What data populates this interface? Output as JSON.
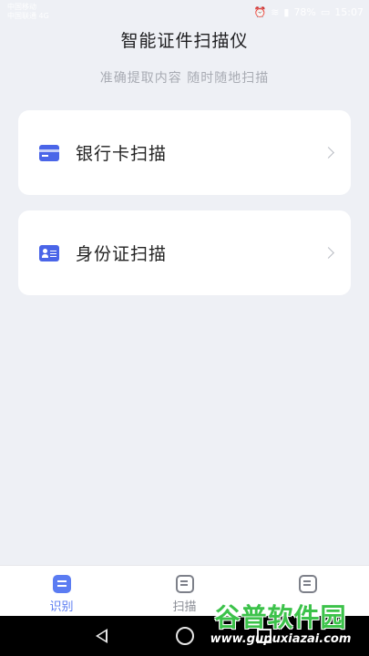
{
  "status_bar": {
    "carrier_line1": "中国移动",
    "carrier_line2": "中国联通 4G",
    "battery": "78%",
    "time": "15:07"
  },
  "header": {
    "title": "智能证件扫描仪",
    "subtitle": "准确提取内容 随时随地扫描"
  },
  "cards": [
    {
      "label": "银行卡扫描",
      "icon": "bank-card-icon"
    },
    {
      "label": "身份证扫描",
      "icon": "id-card-icon"
    }
  ],
  "tabs": [
    {
      "label": "识别",
      "active": true
    },
    {
      "label": "扫描",
      "active": false
    },
    {
      "label": "",
      "active": false
    }
  ],
  "watermark": {
    "logo": "谷普软件园",
    "url": "www.gupuxiazai.com"
  },
  "colors": {
    "accent": "#5b7cf2",
    "card_icon": "#4a65e8",
    "background": "#eef0f5"
  }
}
